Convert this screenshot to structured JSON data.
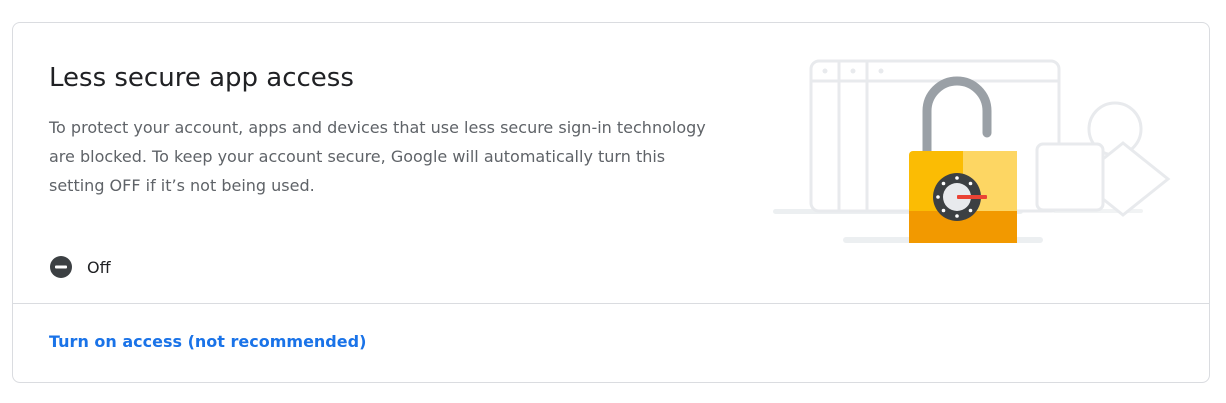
{
  "section": {
    "title": "Less secure app access",
    "description": "To protect your account, apps and devices that use less secure sign-in technology are blocked. To keep your account secure, Google will automatically turn this setting OFF if it’s not being used.",
    "status_icon": "minus-circle-icon",
    "status_label": "Off",
    "action_label": "Turn on access (not recommended)",
    "illustration": "padlock-illustration"
  },
  "colors": {
    "title": "#202124",
    "description": "#5f6368",
    "link": "#1a73e8",
    "status_icon": "#3c4043",
    "border": "#dadce0",
    "lock_yellow": "#fbbc04",
    "lock_orange": "#f29900",
    "dial_dark": "#3c4043",
    "dial_red": "#ea4335"
  }
}
